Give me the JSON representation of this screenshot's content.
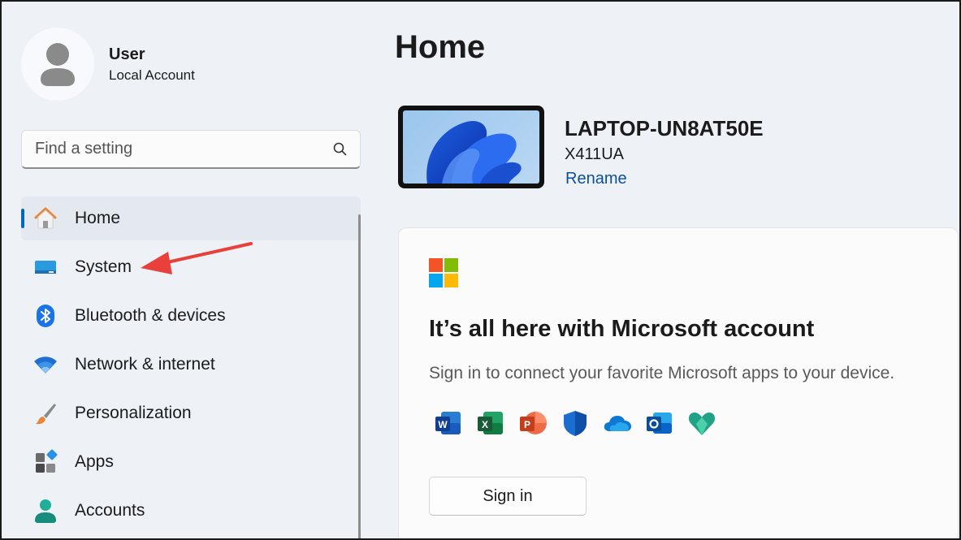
{
  "profile": {
    "name": "User",
    "account_type": "Local Account"
  },
  "search": {
    "placeholder": "Find a setting"
  },
  "nav": {
    "items": [
      {
        "label": "Home",
        "icon": "home-icon",
        "active": true
      },
      {
        "label": "System",
        "icon": "system-icon"
      },
      {
        "label": "Bluetooth & devices",
        "icon": "bluetooth-icon"
      },
      {
        "label": "Network & internet",
        "icon": "wifi-icon"
      },
      {
        "label": "Personalization",
        "icon": "paintbrush-icon"
      },
      {
        "label": "Apps",
        "icon": "apps-icon"
      },
      {
        "label": "Accounts",
        "icon": "accounts-icon"
      }
    ]
  },
  "main": {
    "title": "Home",
    "device": {
      "name": "LAPTOP-UN8AT50E",
      "model": "X411UA",
      "rename_label": "Rename"
    },
    "account_card": {
      "title": "It’s all here with Microsoft account",
      "subtitle": "Sign in to connect your favorite Microsoft apps to your device.",
      "app_icons": [
        "word-icon",
        "excel-icon",
        "powerpoint-icon",
        "defender-icon",
        "onedrive-icon",
        "outlook-icon",
        "family-icon"
      ],
      "signin_label": "Sign in"
    }
  },
  "colors": {
    "accent": "#0067c0",
    "link": "#0b4f9c",
    "annotation_arrow": "#e8403a"
  }
}
